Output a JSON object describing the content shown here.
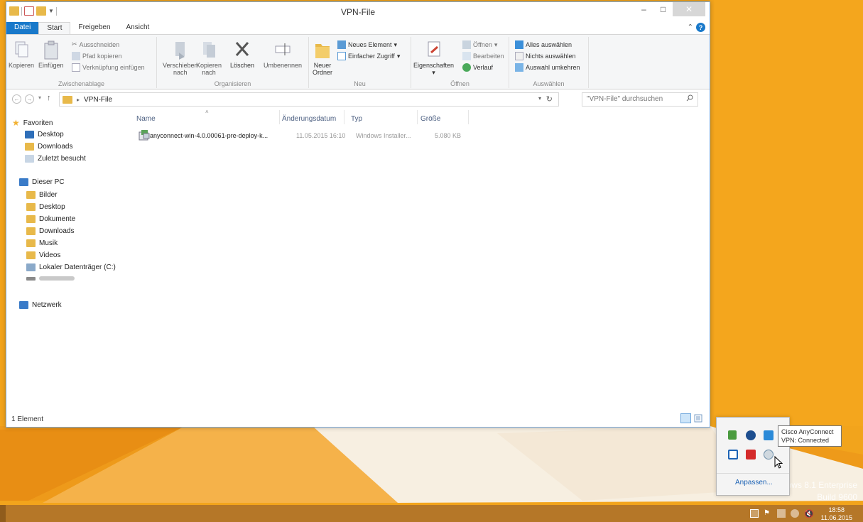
{
  "window": {
    "title": "VPN-File"
  },
  "window_controls": {
    "minimize": "–",
    "maximize": "□",
    "close": "✕"
  },
  "ribbon_tabs": [
    "Datei",
    "Start",
    "Freigeben",
    "Ansicht"
  ],
  "ribbon": {
    "clipboard": {
      "label": "Zwischenablage",
      "copy": "Kopieren",
      "paste": "Einfügen",
      "cut": "Ausschneiden",
      "copy_path": "Pfad kopieren",
      "paste_shortcut": "Verknüpfung einfügen"
    },
    "organize": {
      "label": "Organisieren",
      "move": "Verschieben",
      "move2": "nach",
      "copy_to": "Kopieren",
      "copy_to2": "nach",
      "delete": "Löschen",
      "rename": "Umbenennen"
    },
    "new": {
      "label": "Neu",
      "new_folder": "Neuer",
      "new_folder2": "Ordner",
      "new_item": "Neues Element",
      "easy_access": "Einfacher Zugriff"
    },
    "open": {
      "label": "Öffnen",
      "properties": "Eigenschaften",
      "open": "Öffnen",
      "edit": "Bearbeiten",
      "history": "Verlauf"
    },
    "select": {
      "label": "Auswählen",
      "select_all": "Alles auswählen",
      "select_none": "Nichts auswählen",
      "invert": "Auswahl umkehren"
    }
  },
  "address": {
    "path": "VPN-File",
    "search_placeholder": "\"VPN-File\" durchsuchen"
  },
  "nav": {
    "favorites": "Favoriten",
    "fav_items": [
      "Desktop",
      "Downloads",
      "Zuletzt besucht"
    ],
    "this_pc": "Dieser PC",
    "pc_items": [
      "Bilder",
      "Desktop",
      "Dokumente",
      "Downloads",
      "Musik",
      "Videos",
      "Lokaler Datenträger (C:)"
    ],
    "network": "Netzwerk"
  },
  "columns": {
    "name": "Name",
    "date": "Änderungsdatum",
    "type": "Typ",
    "size": "Größe"
  },
  "files": [
    {
      "name": "anyconnect-win-4.0.00061-pre-deploy-k...",
      "date": "11.05.2015 16:10",
      "type": "Windows Installer...",
      "size": "5.080 KB"
    }
  ],
  "status": {
    "count": "1 Element"
  },
  "tray": {
    "customize": "Anpassen...",
    "tooltip_line1": "Cisco AnyConnect",
    "tooltip_line2": "VPN: Connected"
  },
  "watermark": {
    "line1": "dows 8.1 Enterprise",
    "line2": "Build 9600"
  },
  "clock": {
    "time": "18:58",
    "date": "11.06.2015"
  },
  "colors": {
    "accent": "#1979ca",
    "desktop": "#f2a41c",
    "folder": "#e8b94a"
  }
}
